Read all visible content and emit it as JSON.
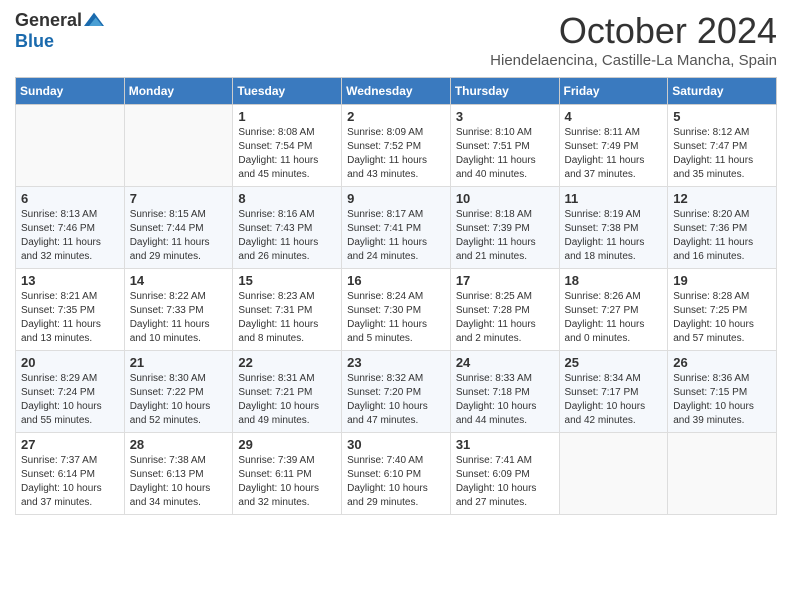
{
  "header": {
    "logo_general": "General",
    "logo_blue": "Blue",
    "title": "October 2024",
    "location": "Hiendelaencina, Castille-La Mancha, Spain"
  },
  "columns": [
    "Sunday",
    "Monday",
    "Tuesday",
    "Wednesday",
    "Thursday",
    "Friday",
    "Saturday"
  ],
  "weeks": [
    [
      {
        "day": "",
        "empty": true
      },
      {
        "day": "",
        "empty": true
      },
      {
        "day": "1",
        "sunrise": "Sunrise: 8:08 AM",
        "sunset": "Sunset: 7:54 PM",
        "daylight": "Daylight: 11 hours and 45 minutes."
      },
      {
        "day": "2",
        "sunrise": "Sunrise: 8:09 AM",
        "sunset": "Sunset: 7:52 PM",
        "daylight": "Daylight: 11 hours and 43 minutes."
      },
      {
        "day": "3",
        "sunrise": "Sunrise: 8:10 AM",
        "sunset": "Sunset: 7:51 PM",
        "daylight": "Daylight: 11 hours and 40 minutes."
      },
      {
        "day": "4",
        "sunrise": "Sunrise: 8:11 AM",
        "sunset": "Sunset: 7:49 PM",
        "daylight": "Daylight: 11 hours and 37 minutes."
      },
      {
        "day": "5",
        "sunrise": "Sunrise: 8:12 AM",
        "sunset": "Sunset: 7:47 PM",
        "daylight": "Daylight: 11 hours and 35 minutes."
      }
    ],
    [
      {
        "day": "6",
        "sunrise": "Sunrise: 8:13 AM",
        "sunset": "Sunset: 7:46 PM",
        "daylight": "Daylight: 11 hours and 32 minutes."
      },
      {
        "day": "7",
        "sunrise": "Sunrise: 8:15 AM",
        "sunset": "Sunset: 7:44 PM",
        "daylight": "Daylight: 11 hours and 29 minutes."
      },
      {
        "day": "8",
        "sunrise": "Sunrise: 8:16 AM",
        "sunset": "Sunset: 7:43 PM",
        "daylight": "Daylight: 11 hours and 26 minutes."
      },
      {
        "day": "9",
        "sunrise": "Sunrise: 8:17 AM",
        "sunset": "Sunset: 7:41 PM",
        "daylight": "Daylight: 11 hours and 24 minutes."
      },
      {
        "day": "10",
        "sunrise": "Sunrise: 8:18 AM",
        "sunset": "Sunset: 7:39 PM",
        "daylight": "Daylight: 11 hours and 21 minutes."
      },
      {
        "day": "11",
        "sunrise": "Sunrise: 8:19 AM",
        "sunset": "Sunset: 7:38 PM",
        "daylight": "Daylight: 11 hours and 18 minutes."
      },
      {
        "day": "12",
        "sunrise": "Sunrise: 8:20 AM",
        "sunset": "Sunset: 7:36 PM",
        "daylight": "Daylight: 11 hours and 16 minutes."
      }
    ],
    [
      {
        "day": "13",
        "sunrise": "Sunrise: 8:21 AM",
        "sunset": "Sunset: 7:35 PM",
        "daylight": "Daylight: 11 hours and 13 minutes."
      },
      {
        "day": "14",
        "sunrise": "Sunrise: 8:22 AM",
        "sunset": "Sunset: 7:33 PM",
        "daylight": "Daylight: 11 hours and 10 minutes."
      },
      {
        "day": "15",
        "sunrise": "Sunrise: 8:23 AM",
        "sunset": "Sunset: 7:31 PM",
        "daylight": "Daylight: 11 hours and 8 minutes."
      },
      {
        "day": "16",
        "sunrise": "Sunrise: 8:24 AM",
        "sunset": "Sunset: 7:30 PM",
        "daylight": "Daylight: 11 hours and 5 minutes."
      },
      {
        "day": "17",
        "sunrise": "Sunrise: 8:25 AM",
        "sunset": "Sunset: 7:28 PM",
        "daylight": "Daylight: 11 hours and 2 minutes."
      },
      {
        "day": "18",
        "sunrise": "Sunrise: 8:26 AM",
        "sunset": "Sunset: 7:27 PM",
        "daylight": "Daylight: 11 hours and 0 minutes."
      },
      {
        "day": "19",
        "sunrise": "Sunrise: 8:28 AM",
        "sunset": "Sunset: 7:25 PM",
        "daylight": "Daylight: 10 hours and 57 minutes."
      }
    ],
    [
      {
        "day": "20",
        "sunrise": "Sunrise: 8:29 AM",
        "sunset": "Sunset: 7:24 PM",
        "daylight": "Daylight: 10 hours and 55 minutes."
      },
      {
        "day": "21",
        "sunrise": "Sunrise: 8:30 AM",
        "sunset": "Sunset: 7:22 PM",
        "daylight": "Daylight: 10 hours and 52 minutes."
      },
      {
        "day": "22",
        "sunrise": "Sunrise: 8:31 AM",
        "sunset": "Sunset: 7:21 PM",
        "daylight": "Daylight: 10 hours and 49 minutes."
      },
      {
        "day": "23",
        "sunrise": "Sunrise: 8:32 AM",
        "sunset": "Sunset: 7:20 PM",
        "daylight": "Daylight: 10 hours and 47 minutes."
      },
      {
        "day": "24",
        "sunrise": "Sunrise: 8:33 AM",
        "sunset": "Sunset: 7:18 PM",
        "daylight": "Daylight: 10 hours and 44 minutes."
      },
      {
        "day": "25",
        "sunrise": "Sunrise: 8:34 AM",
        "sunset": "Sunset: 7:17 PM",
        "daylight": "Daylight: 10 hours and 42 minutes."
      },
      {
        "day": "26",
        "sunrise": "Sunrise: 8:36 AM",
        "sunset": "Sunset: 7:15 PM",
        "daylight": "Daylight: 10 hours and 39 minutes."
      }
    ],
    [
      {
        "day": "27",
        "sunrise": "Sunrise: 7:37 AM",
        "sunset": "Sunset: 6:14 PM",
        "daylight": "Daylight: 10 hours and 37 minutes."
      },
      {
        "day": "28",
        "sunrise": "Sunrise: 7:38 AM",
        "sunset": "Sunset: 6:13 PM",
        "daylight": "Daylight: 10 hours and 34 minutes."
      },
      {
        "day": "29",
        "sunrise": "Sunrise: 7:39 AM",
        "sunset": "Sunset: 6:11 PM",
        "daylight": "Daylight: 10 hours and 32 minutes."
      },
      {
        "day": "30",
        "sunrise": "Sunrise: 7:40 AM",
        "sunset": "Sunset: 6:10 PM",
        "daylight": "Daylight: 10 hours and 29 minutes."
      },
      {
        "day": "31",
        "sunrise": "Sunrise: 7:41 AM",
        "sunset": "Sunset: 6:09 PM",
        "daylight": "Daylight: 10 hours and 27 minutes."
      },
      {
        "day": "",
        "empty": true
      },
      {
        "day": "",
        "empty": true
      }
    ]
  ]
}
